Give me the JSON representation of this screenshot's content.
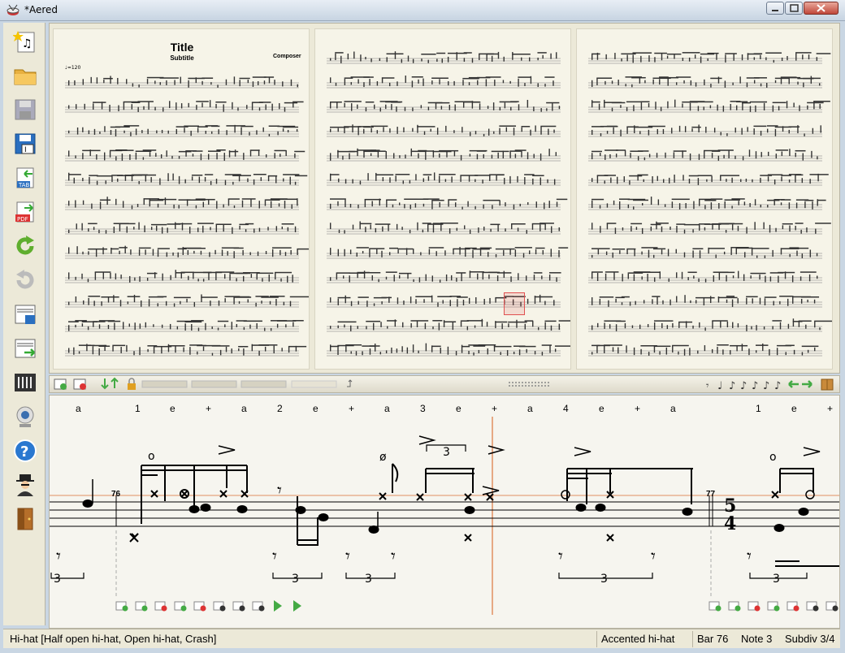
{
  "window": {
    "title": "*Aered"
  },
  "score_pages": [
    {
      "title": "Title",
      "subtitle": "Subtitle",
      "composer": "Composer",
      "tempo": "♩=120"
    },
    {},
    {}
  ],
  "editor": {
    "counts": [
      "a",
      "1",
      "e",
      "+",
      "a",
      "2",
      "e",
      "+",
      "a",
      "3",
      "e",
      "+",
      "a",
      "4",
      "e",
      "+",
      "a",
      "1",
      "e",
      "+"
    ],
    "bar_numbers": [
      "76",
      "77"
    ],
    "time_signature": {
      "top": "5",
      "bottom": "4"
    },
    "tuplet_labels": [
      "3",
      "3",
      "3",
      "3",
      "3",
      "3"
    ],
    "note_symbols": {
      "open": "o",
      "half_open": "ø"
    }
  },
  "status": {
    "instrument": "Hi-hat [Half open hi-hat, Open hi-hat, Crash]",
    "articulation": "Accented hi-hat",
    "bar": "Bar 76",
    "note": "Note 3",
    "subdiv": "Subdiv 3/4"
  },
  "toolbar_left": [
    "new-file",
    "open-folder",
    "save",
    "save-as",
    "export-tab",
    "export-pdf",
    "redo",
    "undo",
    "page-layout",
    "page-export",
    "mixer",
    "webcam",
    "help",
    "user",
    "exit-door"
  ],
  "colors": {
    "accent_orange": "#e09060",
    "selection_red": "#e05050"
  }
}
